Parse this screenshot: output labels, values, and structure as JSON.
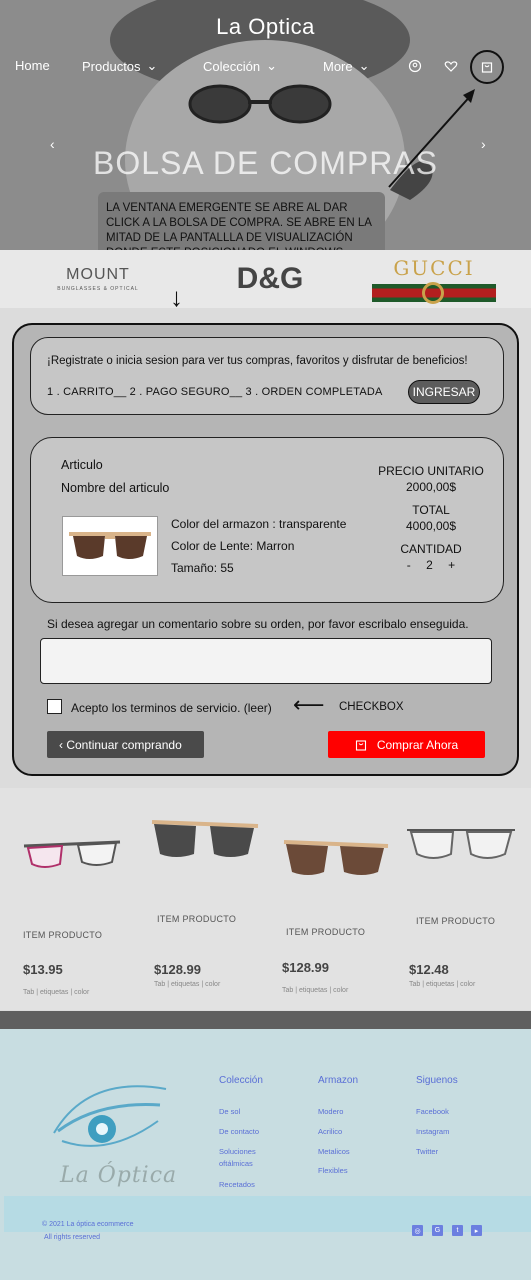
{
  "header": {
    "brand": "La Optica",
    "nav": [
      {
        "label": "Home"
      },
      {
        "label": "Productos"
      },
      {
        "label": "Colección"
      },
      {
        "label": "More"
      }
    ],
    "icons": [
      "user-icon",
      "heart-icon",
      "shopping-bag-icon"
    ]
  },
  "hero": {
    "headline": "BOLSA DE COMPRAS"
  },
  "annotation": {
    "text": "LA VENTANA EMERGENTE SE ABRE AL DAR CLICK A LA BOLSA DE COMPRA. SE ABRE EN LA MITAD DE LA PANTALLLA DE VISUALIZACIÓN DONDE ESTE POSICIONADO EL WINDOWS",
    "checkbox_note": "CHECKBOX"
  },
  "brands": {
    "mount": "MOUNT",
    "mount_sub": "BUNGLASSES & OPTICAL",
    "dg": "D&G",
    "gucci": "GUCCI"
  },
  "cart": {
    "login_message": "¡Registrate o inicia sesion para ver tus compras, favoritos y disfrutar de beneficios!",
    "steps": "1 . CARRITO__   2 . PAGO SEGURO__   3 . ORDEN COMPLETADA",
    "login_button": "INGRESAR",
    "item": {
      "section_label": "Articulo",
      "name": "Nombre del articulo",
      "frame_color": "Color del armazon : transparente",
      "lens_color": "Color de Lente: Marron",
      "size": "Tamaño: 55",
      "unit_price_label": "PRECIO UNITARIO",
      "unit_price": "2000,00$",
      "total_label": "TOTAL",
      "total": "4000,00$",
      "quantity_label": "CANTIDAD",
      "minus": "-",
      "quantity": "2",
      "plus": "+"
    },
    "comment_label": "Si desea agregar un comentario sobre su orden, por favor escribalo enseguida.",
    "comment_value": "",
    "terms": "Acepto los terminos de servicio. (leer)",
    "continue_button": "Continuar comprando",
    "buy_button": "Comprar Ahora"
  },
  "products": [
    {
      "name": "ITEM PRODUCTO",
      "price": "$13.95",
      "tags": "Tab | etiquetas | color"
    },
    {
      "name": "ITEM PRODUCTO",
      "price": "$128.99",
      "tags": "Tab | etiquetas | color"
    },
    {
      "name": "ITEM PRODUCTO",
      "price": "$128.99",
      "tags": "Tab | etiquetas | color"
    },
    {
      "name": "ITEM PRODUCTO",
      "price": "$12.48",
      "tags": "Tab | etiquetas | color"
    }
  ],
  "footer": {
    "logo_text": "La Óptica",
    "columns": [
      {
        "title": "Colección",
        "links": [
          "De sol",
          "De contacto",
          "Soluciones oftálmicas",
          "Recetados"
        ]
      },
      {
        "title": "Armazon",
        "links": [
          "Modero",
          "Acrilico",
          "Metalicos",
          "Flexibles"
        ]
      },
      {
        "title": "Siguenos",
        "links": [
          "Facebook",
          "Instagram",
          "Twitter"
        ]
      }
    ],
    "copyright": "© 2021 La óptica ecommerce",
    "rights": "All rights reserved",
    "social_icons": [
      "instagram-icon",
      "google-icon",
      "twitter-icon",
      "youtube-icon"
    ]
  },
  "colors": {
    "buy_button": "#ff0000",
    "footer_bg": "#c8dde1",
    "footer_link": "#5a6fd6"
  }
}
